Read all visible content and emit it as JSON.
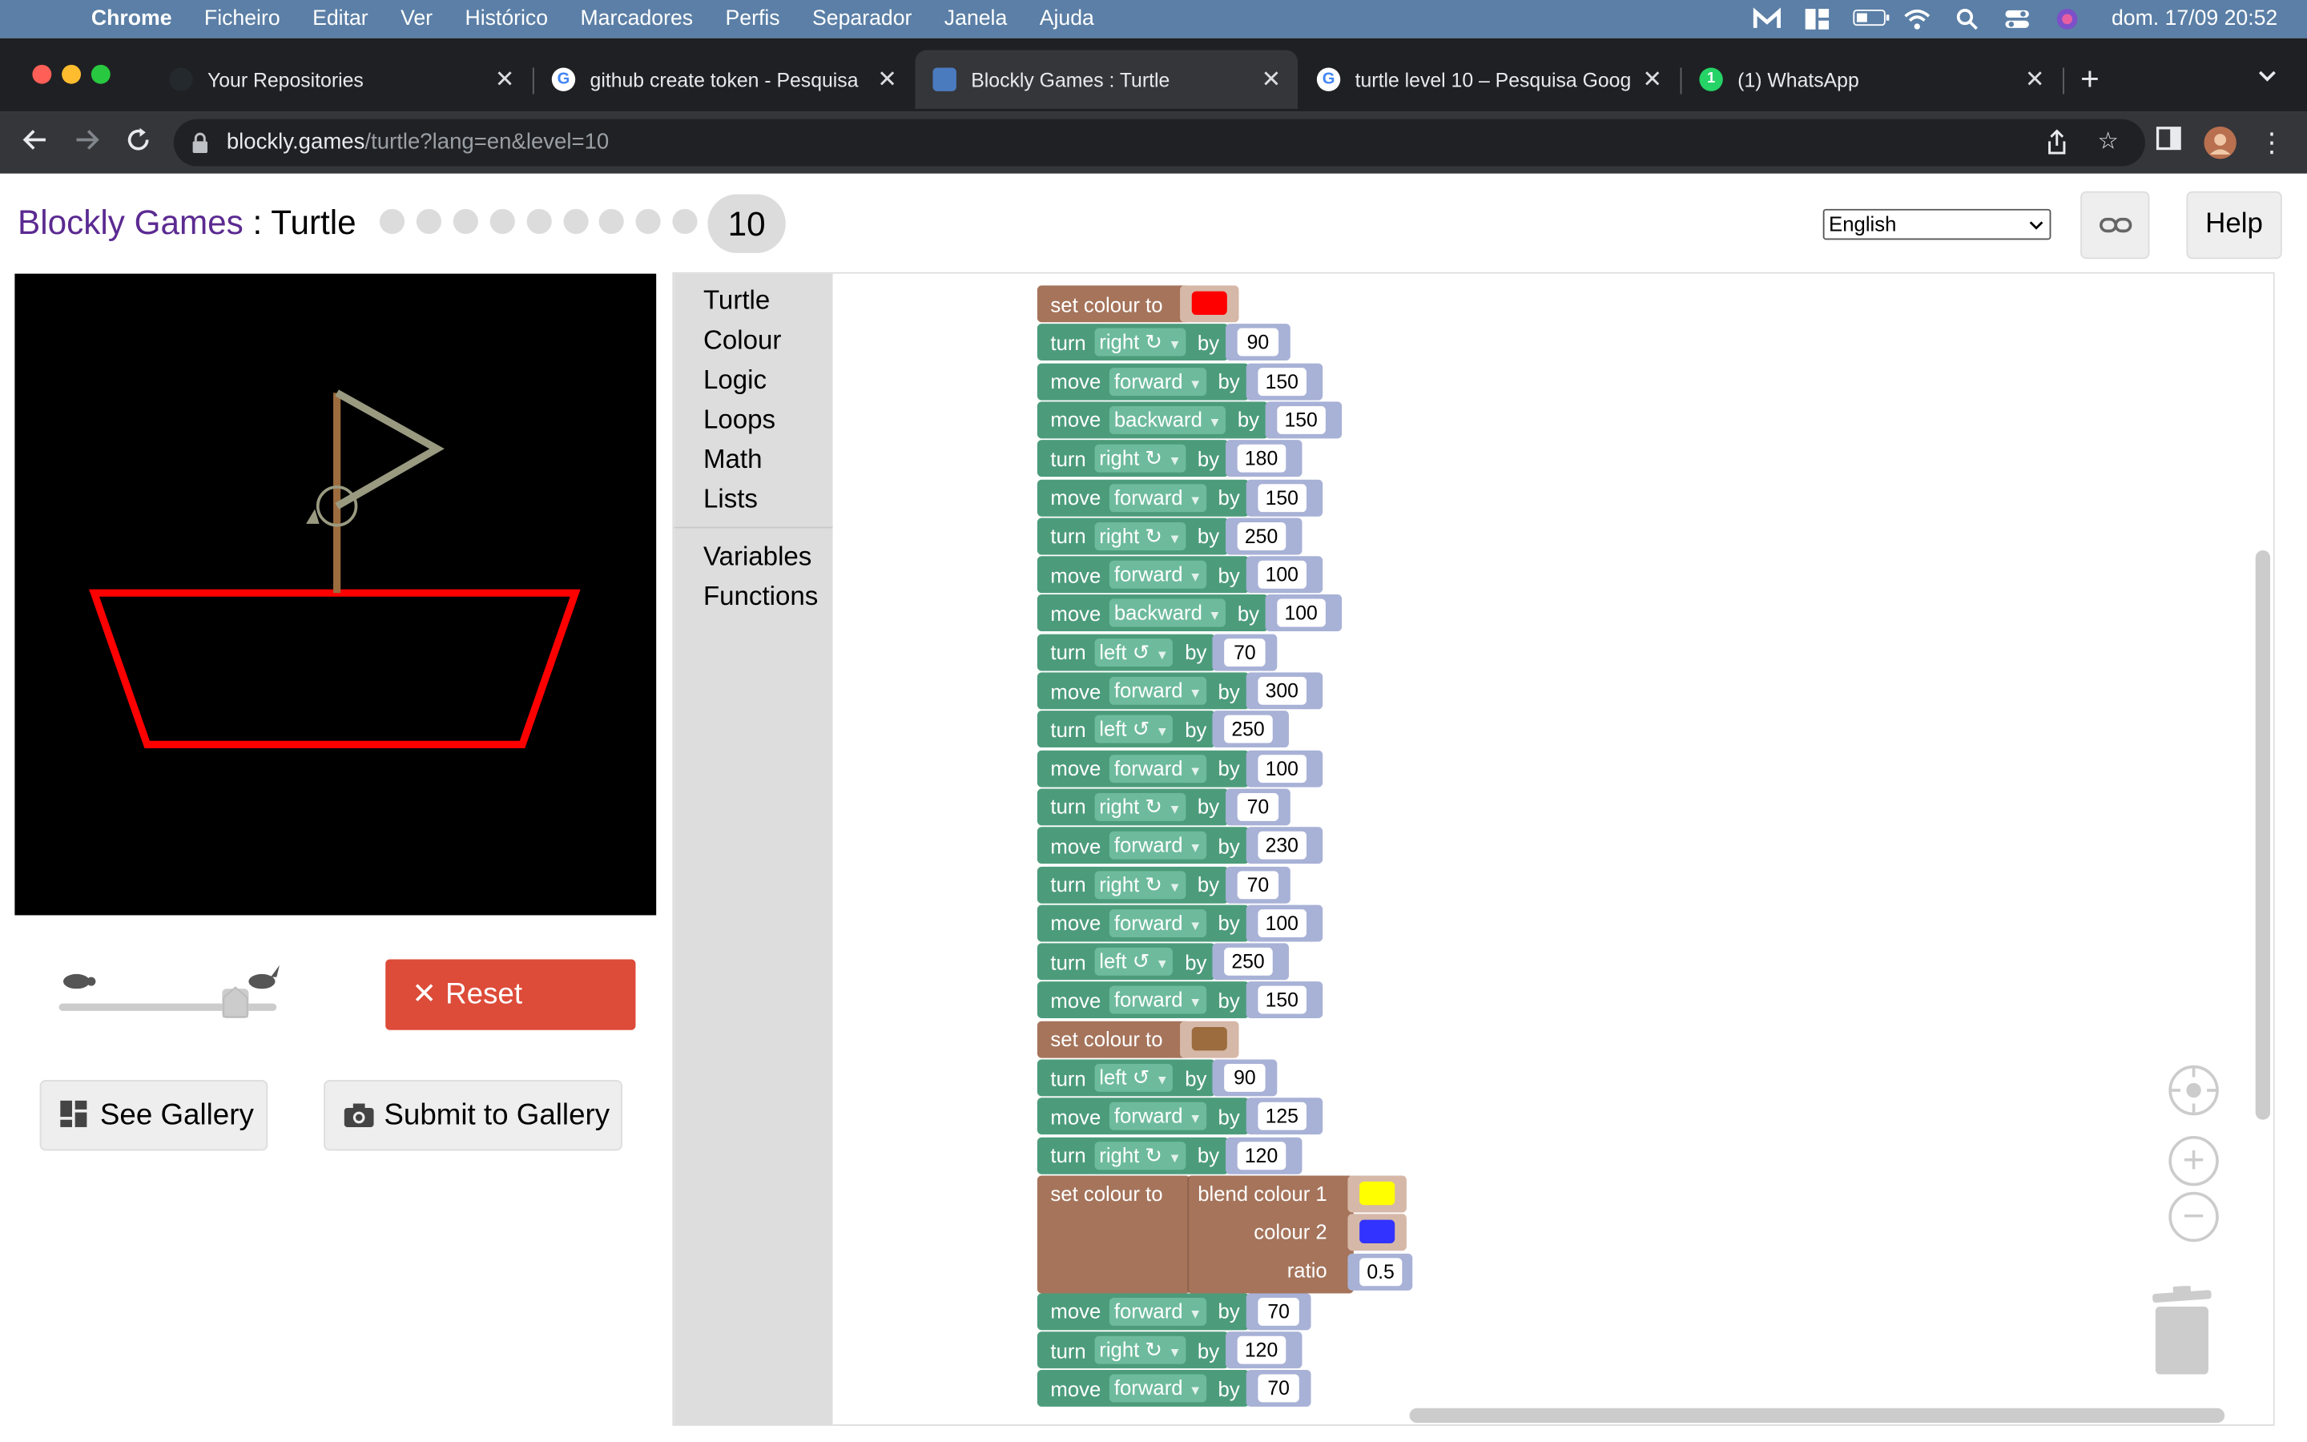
{
  "menubar": {
    "app": "Chrome",
    "items": [
      "Ficheiro",
      "Editar",
      "Ver",
      "Histórico",
      "Marcadores",
      "Perfis",
      "Separador",
      "Janela",
      "Ajuda"
    ],
    "clock": "dom. 17/09  20:52"
  },
  "tabs": [
    {
      "label": "Your Repositories",
      "icon": "github-icon"
    },
    {
      "label": "github create token - Pesquisa",
      "icon": "google-icon"
    },
    {
      "label": "Blockly Games : Turtle",
      "icon": "blockly-icon"
    },
    {
      "label": "turtle level 10 – Pesquisa Goog",
      "icon": "google-icon"
    },
    {
      "label": "(1) WhatsApp",
      "icon": "whatsapp-icon"
    }
  ],
  "address": {
    "host": "blockly.games",
    "path": "/turtle?lang=en&level=10"
  },
  "header": {
    "brand": "Blockly Games",
    "separator": " : ",
    "game": "Turtle",
    "level": "10",
    "language": "English",
    "help_label": "Help"
  },
  "controls": {
    "reset_label": "Reset",
    "gallery_label": "See Gallery",
    "submit_label": "Submit to Gallery",
    "speed_fraction": 0.85
  },
  "toolbox": {
    "categories": [
      "Turtle",
      "Colour",
      "Logic",
      "Loops",
      "Math",
      "Lists"
    ],
    "extra": [
      "Variables",
      "Functions"
    ]
  },
  "program": {
    "blocks": [
      {
        "kind": "colour",
        "text": "set colour to",
        "colour": "#ff0000"
      },
      {
        "kind": "turn",
        "verb": "turn",
        "dir": "right ↻",
        "by": "by",
        "value": "90"
      },
      {
        "kind": "move",
        "verb": "move",
        "dir": "forward",
        "by": "by",
        "value": "150"
      },
      {
        "kind": "move",
        "verb": "move",
        "dir": "backward",
        "by": "by",
        "value": "150"
      },
      {
        "kind": "turn",
        "verb": "turn",
        "dir": "right ↻",
        "by": "by",
        "value": "180"
      },
      {
        "kind": "move",
        "verb": "move",
        "dir": "forward",
        "by": "by",
        "value": "150"
      },
      {
        "kind": "turn",
        "verb": "turn",
        "dir": "right ↻",
        "by": "by",
        "value": "250"
      },
      {
        "kind": "move",
        "verb": "move",
        "dir": "forward",
        "by": "by",
        "value": "100"
      },
      {
        "kind": "move",
        "verb": "move",
        "dir": "backward",
        "by": "by",
        "value": "100"
      },
      {
        "kind": "turn",
        "verb": "turn",
        "dir": "left ↺",
        "by": "by",
        "value": "70"
      },
      {
        "kind": "move",
        "verb": "move",
        "dir": "forward",
        "by": "by",
        "value": "300"
      },
      {
        "kind": "turn",
        "verb": "turn",
        "dir": "left ↺",
        "by": "by",
        "value": "250"
      },
      {
        "kind": "move",
        "verb": "move",
        "dir": "forward",
        "by": "by",
        "value": "100"
      },
      {
        "kind": "turn",
        "verb": "turn",
        "dir": "right ↻",
        "by": "by",
        "value": "70"
      },
      {
        "kind": "move",
        "verb": "move",
        "dir": "forward",
        "by": "by",
        "value": "230"
      },
      {
        "kind": "turn",
        "verb": "turn",
        "dir": "right ↻",
        "by": "by",
        "value": "70"
      },
      {
        "kind": "move",
        "verb": "move",
        "dir": "forward",
        "by": "by",
        "value": "100"
      },
      {
        "kind": "turn",
        "verb": "turn",
        "dir": "left ↺",
        "by": "by",
        "value": "250"
      },
      {
        "kind": "move",
        "verb": "move",
        "dir": "forward",
        "by": "by",
        "value": "150"
      },
      {
        "kind": "colour",
        "text": "set colour to",
        "colour": "#9c6b3e"
      },
      {
        "kind": "turn",
        "verb": "turn",
        "dir": "left ↺",
        "by": "by",
        "value": "90"
      },
      {
        "kind": "move",
        "verb": "move",
        "dir": "forward",
        "by": "by",
        "value": "125"
      },
      {
        "kind": "turn",
        "verb": "turn",
        "dir": "right ↻",
        "by": "by",
        "value": "120"
      },
      {
        "kind": "blend",
        "text": "set colour to",
        "blend_label": "blend colour 1",
        "colour2_label": "colour 2",
        "ratio_label": "ratio",
        "colour1": "#ffff00",
        "colour2": "#3333ff",
        "ratio": "0.5"
      },
      {
        "kind": "move",
        "verb": "move",
        "dir": "forward",
        "by": "by",
        "value": "70"
      },
      {
        "kind": "turn",
        "verb": "turn",
        "dir": "right ↻",
        "by": "by",
        "value": "120"
      },
      {
        "kind": "move",
        "verb": "move",
        "dir": "forward",
        "by": "by",
        "value": "70"
      }
    ]
  },
  "colors": {
    "menubar": "#5b7fa6",
    "reset": "#dd4b39",
    "turtle_block": "#4c9c7c",
    "colour_block": "#a5745b",
    "brand": "#5b2a91"
  }
}
